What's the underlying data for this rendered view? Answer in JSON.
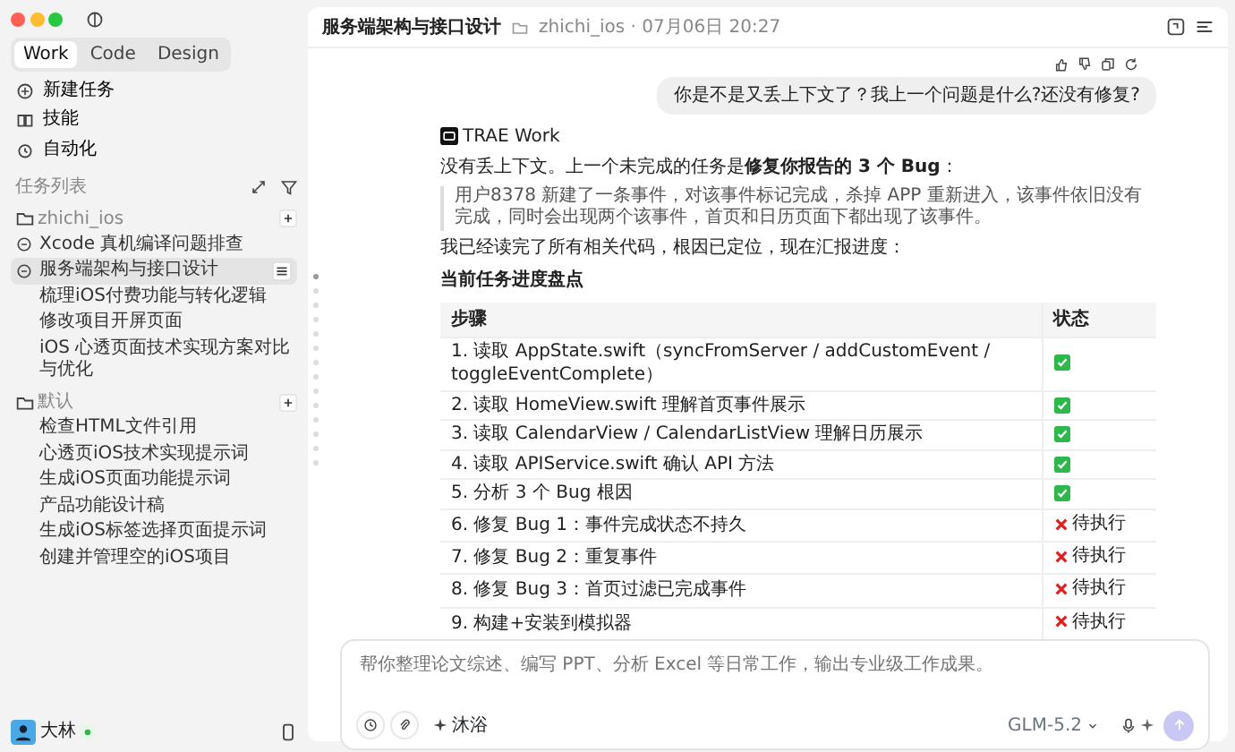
{
  "window": {
    "traffic_lights": [
      {
        "color": "#ff5f57"
      },
      {
        "color": "#febc2e"
      },
      {
        "color": "#28c840"
      }
    ]
  },
  "sidebar": {
    "mode_tabs": [
      {
        "label": "Work",
        "selected": true
      },
      {
        "label": "Code",
        "selected": false
      },
      {
        "label": "Design",
        "selected": false
      }
    ],
    "nav": [
      {
        "label": "新建任务"
      },
      {
        "label": "技能"
      },
      {
        "label": "自动化"
      }
    ],
    "task_list_title": "任务列表",
    "groups": [
      {
        "folder": "zhichi_ios",
        "tasks": [
          {
            "label": "Xcode 真机编译问题排查",
            "kind": "session",
            "selected": false
          },
          {
            "label": "服务端架构与接口设计",
            "kind": "session",
            "selected": true
          },
          {
            "label": "梳理iOS付费功能与转化逻辑",
            "kind": "plain",
            "selected": false
          },
          {
            "label": "修改项目开屏页面",
            "kind": "plain",
            "selected": false
          },
          {
            "label": "iOS 心透页面技术实现方案对比与优化",
            "kind": "plain",
            "selected": false
          }
        ]
      },
      {
        "folder": "默认",
        "tasks": [
          {
            "label": "检查HTML文件引用",
            "kind": "plain",
            "selected": false
          },
          {
            "label": "心透页iOS技术实现提示词",
            "kind": "plain",
            "selected": false
          },
          {
            "label": "生成iOS页面功能提示词",
            "kind": "plain",
            "selected": false
          },
          {
            "label": "产品功能设计稿",
            "kind": "plain",
            "selected": false
          },
          {
            "label": "生成iOS标签选择页面提示词",
            "kind": "plain",
            "selected": false
          },
          {
            "label": "创建并管理空的iOS项目",
            "kind": "plain",
            "selected": false
          }
        ]
      }
    ],
    "user": {
      "name": "大林"
    }
  },
  "header": {
    "title": "服务端架构与接口设计",
    "meta": "zhichi_ios · 07月06日 20:27"
  },
  "user_message": "你是不是又丢上下文了？我上一个问题是什么?还没有修复?",
  "assistant": {
    "name": "TRAE Work",
    "intro": "没有丢上下文。上一个未完成的任务是**修复你报告的 3 个 Bug**：",
    "quote": "用户8378 新建了一条事件，对该事件标记完成，杀掉 APP 重新进入，该事件依旧没有完成，同时会出现两个该事件，首页和日历页面下都出现了该事件。",
    "progress": "我已经读完了所有相关代码，根因已定位，现在汇报进度：",
    "heading": "当前任务进度盘点",
    "table": {
      "columns": [
        "步骤",
        "状态"
      ],
      "rows": [
        {
          "step": "1. 读取 AppState.swift（syncFromServer / addCustomEvent / toggleEventComplete）",
          "done": true
        },
        {
          "step": "2. 读取 HomeView.swift 理解首页事件展示",
          "done": true
        },
        {
          "step": "3. 读取 CalendarView / CalendarListView 理解日历展示",
          "done": true
        },
        {
          "step": "4. 读取 APIService.swift 确认 API 方法",
          "done": true
        },
        {
          "step": "5. 分析 3 个 Bug 根因",
          "done": true
        },
        {
          "step": "6. 修复 Bug 1：事件完成状态不持久",
          "done": false,
          "status": "待执行"
        },
        {
          "step": "7. 修复 Bug 2：重复事件",
          "done": false,
          "status": "待执行"
        },
        {
          "step": "8. 修复 Bug 3：首页过滤已完成事件",
          "done": false,
          "status": "待执行"
        },
        {
          "step": "9. 构建+安装到模拟器",
          "done": false,
          "status": "待执行"
        }
      ]
    }
  },
  "composer": {
    "placeholder": "帮你整理论文综述、编写 PPT、分析 Excel 等日常工作，输出专业级工作成果。",
    "mode": "沐浴",
    "model": "GLM-5.2"
  }
}
